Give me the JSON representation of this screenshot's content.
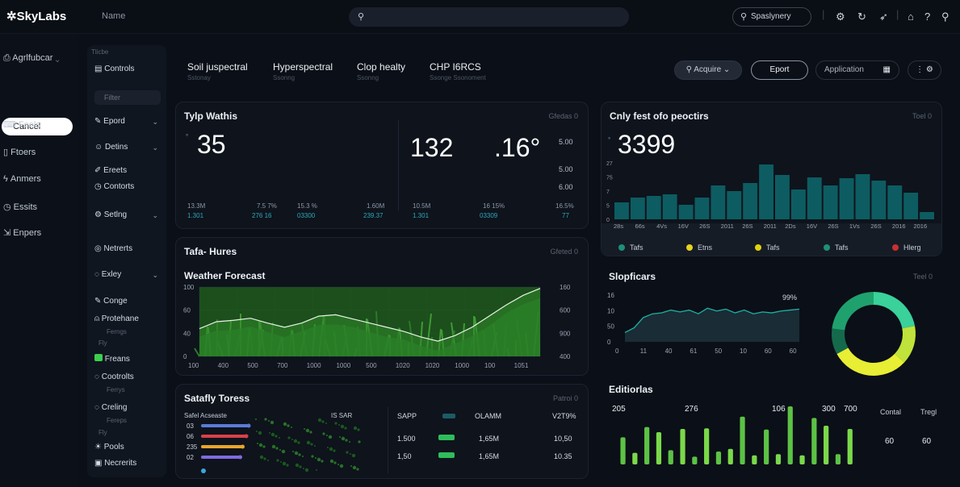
{
  "topbar": {
    "logo": "✲SkyLabs",
    "app_name": "Name",
    "search_placeholder": "",
    "button_label": "Spaslynery"
  },
  "rail": {
    "items": [
      "Agrlfubcar",
      "Cancel",
      "Feels",
      "Ftoers",
      "Anmers",
      "Essits",
      "Enpers"
    ]
  },
  "sidebar": {
    "section": "Tlicbe",
    "top_item": "Controls",
    "filter_placeholder": "Filter",
    "items": [
      "Epord",
      "Detins",
      "Ereets",
      "Contorts",
      "Setlng",
      "Netrerts",
      "Exley",
      "Conge",
      "Protehane",
      "Freans",
      "Cootrolts",
      "Creling",
      "Pools",
      "Necrerits"
    ],
    "subs": [
      "Ferngs",
      "Fly",
      "Ferrys",
      "Fereps",
      "Fly"
    ]
  },
  "tabs": [
    {
      "label": "Soil juspectral",
      "sub": "Sstonay"
    },
    {
      "label": "Hyperspectral",
      "sub": "Ssonng"
    },
    {
      "label": "Clop healty",
      "sub": "Ssonng"
    },
    {
      "label": "CHP I6RCS",
      "sub": "Ssonge Ssonoment"
    }
  ],
  "actions": {
    "acquire": "Acquire",
    "export": "Eport",
    "application": "Application"
  },
  "card_weather_stats": {
    "title": "Tylp Wathis",
    "tag": "Gfedas 0",
    "big1": "35",
    "big2": "132",
    "big3": ".16°",
    "side_values": [
      "5.00",
      "5.00",
      "6.00"
    ],
    "stats": [
      {
        "k": "13.3M",
        "v": "1.301"
      },
      {
        "k": "7.5 7%",
        "v": "276 16"
      },
      {
        "k": "15.3 %",
        "v": "03300"
      },
      {
        "k": "1.60M",
        "v": "239.37"
      },
      {
        "k": "10.5M",
        "v": "1.301"
      },
      {
        "k": "16 15%",
        "v": "03309"
      },
      {
        "k": "16.5%",
        "v": "77"
      }
    ]
  },
  "card_bars": {
    "title": "Cnly fest ofo peoctirs",
    "tag": "Toel 0",
    "value": "3399",
    "legend": [
      {
        "label": "Tafs",
        "color": "#1e8f7a"
      },
      {
        "label": "Etns",
        "color": "#e8d31d"
      },
      {
        "label": "Tafs",
        "color": "#e2d10f"
      },
      {
        "label": "Tafs",
        "color": "#1e8f7a"
      },
      {
        "label": "Hlerg",
        "color": "#c83030"
      }
    ]
  },
  "chart_top_bars": {
    "type": "bar",
    "categories": [
      "28s",
      "66s",
      "4Vs",
      "16V",
      "26S",
      "2011",
      "26S",
      "2011",
      "2Ds",
      "16V",
      "26S",
      "1Vs",
      "26S",
      "2016",
      "2016"
    ],
    "values": [
      2.1,
      2.7,
      2.9,
      3.1,
      1.8,
      2.7,
      4.2,
      3.5,
      4.5,
      6.8,
      5.5,
      3.7,
      5.2,
      4.2,
      5.1,
      5.6,
      4.8,
      4.2,
      3.3,
      0.9
    ],
    "y_ticks": [
      "0",
      "5",
      "7",
      "75",
      "27"
    ],
    "color": "#0d5c61"
  },
  "card_forecast": {
    "title": "Tafa- Hures",
    "tag": "Gfeted 0",
    "subtitle": "Weather Forecast",
    "y_left": [
      "100",
      "60",
      "40",
      "0"
    ],
    "y_right": [
      "160",
      "600",
      "900",
      "400"
    ],
    "x_ticks": [
      "100",
      "400",
      "500",
      "700",
      "1000",
      "1000",
      "500",
      "1020",
      "1020",
      "1000",
      "100",
      "1051"
    ]
  },
  "chart_forecast": {
    "type": "area",
    "x": [
      0,
      1,
      2,
      3,
      4,
      5,
      6,
      7,
      8,
      9,
      10,
      11,
      12,
      13,
      14,
      15,
      16,
      17,
      18,
      19,
      20
    ],
    "values": [
      40,
      50,
      52,
      55,
      48,
      42,
      48,
      58,
      60,
      54,
      48,
      42,
      36,
      28,
      22,
      30,
      42,
      58,
      74,
      88,
      98
    ],
    "ylim": [
      0,
      100
    ]
  },
  "card_mini_line": {
    "title": "Slopficars",
    "tag": "Teel 0",
    "annotation": "99%",
    "y_ticks": [
      "16",
      "10",
      "50",
      "0"
    ],
    "x_ticks": [
      "0",
      "11",
      "40",
      "61",
      "50",
      "10",
      "60",
      "60"
    ]
  },
  "chart_mini_line": {
    "type": "area",
    "x": [
      0,
      1,
      2,
      3,
      4,
      5,
      6,
      7,
      8,
      9,
      10,
      11,
      12,
      13,
      14,
      15,
      16,
      17,
      18,
      19
    ],
    "values": [
      20,
      30,
      52,
      60,
      62,
      68,
      64,
      68,
      60,
      72,
      66,
      70,
      62,
      68,
      60,
      64,
      62,
      66,
      68,
      70
    ],
    "ylim": [
      0,
      100
    ]
  },
  "chart_donut": {
    "type": "pie",
    "values": [
      22,
      15,
      30,
      10,
      23
    ],
    "colors": [
      "#3ad19b",
      "#bfe33a",
      "#e7ee33",
      "#156a4c",
      "#1fa16e"
    ]
  },
  "card_safety": {
    "title": "Satafly Toress",
    "tag": "Patroi 0",
    "list_header": "Safel Acseaste",
    "list_header_right": "IS SAR",
    "rows": [
      {
        "label": "03",
        "color": "#5b7bd6",
        "w": 0.7
      },
      {
        "label": "06",
        "color": "#d9414a",
        "w": 0.6
      },
      {
        "label": "235",
        "color": "#e8a52b",
        "w": 0.45
      },
      {
        "label": "02",
        "color": "#7f6be0",
        "w": 0.35
      }
    ],
    "table_headers": [
      "SAPP",
      "",
      "OLAMM",
      "V2T9%"
    ],
    "table_rows": [
      [
        "1.500",
        "",
        "1,65M",
        "10,50"
      ],
      [
        "1,50",
        "",
        "1,65M",
        "10.35"
      ]
    ]
  },
  "card_editorials": {
    "title": "Editiorlas",
    "labels": [
      "205",
      "276",
      "106",
      "300",
      "700"
    ],
    "right_headers": [
      "Contal",
      "Tregl"
    ],
    "right_values": [
      "60",
      "60"
    ]
  },
  "chart_editorials": {
    "type": "bar",
    "values": [
      42,
      18,
      58,
      50,
      22,
      55,
      12,
      56,
      20,
      24,
      74,
      14,
      54,
      16,
      90,
      14,
      72,
      60,
      16,
      55
    ],
    "colors": [
      "#5cc245",
      "#7ad94a"
    ]
  }
}
